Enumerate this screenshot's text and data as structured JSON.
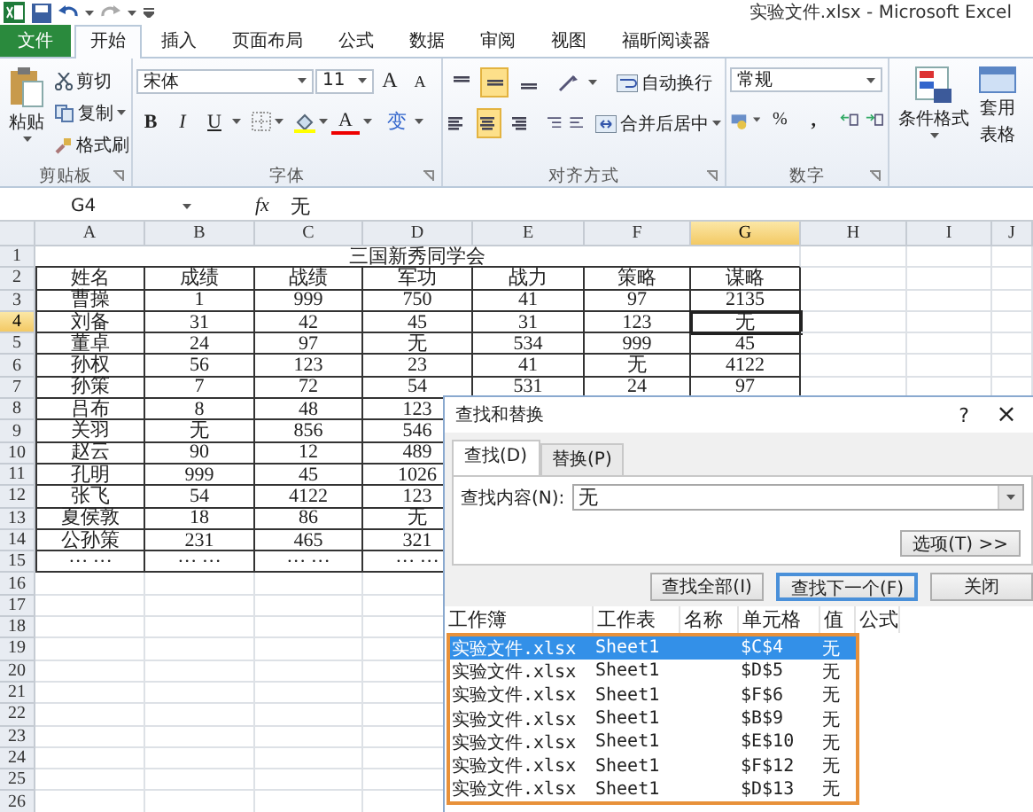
{
  "title_bar": {
    "title": "实验文件.xlsx - Microsoft Excel"
  },
  "ribbon_tabs": [
    {
      "label": "文件",
      "kind": "file",
      "selected": false
    },
    {
      "label": "开始",
      "kind": "tab",
      "selected": true
    },
    {
      "label": "插入",
      "kind": "tab",
      "selected": false
    },
    {
      "label": "页面布局",
      "kind": "tab",
      "selected": false
    },
    {
      "label": "公式",
      "kind": "tab",
      "selected": false
    },
    {
      "label": "数据",
      "kind": "tab",
      "selected": false
    },
    {
      "label": "审阅",
      "kind": "tab",
      "selected": false
    },
    {
      "label": "视图",
      "kind": "tab",
      "selected": false
    },
    {
      "label": "福昕阅读器",
      "kind": "tab",
      "selected": false
    }
  ],
  "clipboard": {
    "paste": "粘贴",
    "cut": "剪切",
    "copy": "复制",
    "format_painter": "格式刷",
    "group": "剪贴板"
  },
  "font": {
    "name": "宋体",
    "size": "11",
    "grow": "A",
    "shrink": "A",
    "bold": "B",
    "italic": "I",
    "underline": "U",
    "font_color_label": "A",
    "phonetic": "变",
    "group": "字体"
  },
  "alignment": {
    "vertical": [
      {
        "kind": "top",
        "selected": false
      },
      {
        "kind": "middle",
        "selected": true
      },
      {
        "kind": "bottom",
        "selected": false
      }
    ],
    "horizontal": [
      {
        "kind": "left",
        "selected": false
      },
      {
        "kind": "center",
        "selected": true
      },
      {
        "kind": "right",
        "selected": false
      }
    ],
    "wrap": "自动换行",
    "merge": "合并后居中",
    "group": "对齐方式"
  },
  "number": {
    "format": "常规",
    "percent": "%",
    "comma": ",",
    "group": "数字"
  },
  "styles": {
    "conditional": "条件格式",
    "table_format_top": "套用",
    "table_format_bottom": "表格"
  },
  "formula_bar": {
    "name_box": "G4",
    "function_label": "fx",
    "value": "无"
  },
  "sheet": {
    "title": "三国新秀同学会",
    "columns": [
      {
        "label": "A",
        "selected": false
      },
      {
        "label": "B",
        "selected": false
      },
      {
        "label": "C",
        "selected": false
      },
      {
        "label": "D",
        "selected": false
      },
      {
        "label": "E",
        "selected": false
      },
      {
        "label": "F",
        "selected": false
      },
      {
        "label": "G",
        "selected": true
      },
      {
        "label": "H",
        "selected": false
      },
      {
        "label": "I",
        "selected": false
      },
      {
        "label": "J",
        "selected": false
      }
    ],
    "rows": [
      {
        "label": "1",
        "selected": false
      },
      {
        "label": "2",
        "selected": false,
        "cells": [
          "姓名",
          "成绩",
          "战绩",
          "军功",
          "战力",
          "策略",
          "谋略"
        ]
      },
      {
        "label": "3",
        "selected": false,
        "cells": [
          "曹操",
          "1",
          "999",
          "750",
          "41",
          "97",
          "2135"
        ]
      },
      {
        "label": "4",
        "selected": true,
        "cells": [
          "刘备",
          "31",
          "42",
          "45",
          "31",
          "123",
          "无"
        ]
      },
      {
        "label": "5",
        "selected": false,
        "cells": [
          "董卓",
          "24",
          "97",
          "无",
          "534",
          "999",
          "45"
        ]
      },
      {
        "label": "6",
        "selected": false,
        "cells": [
          "孙权",
          "56",
          "123",
          "23",
          "41",
          "无",
          "4122"
        ]
      },
      {
        "label": "7",
        "selected": false,
        "cells": [
          "孙策",
          "7",
          "72",
          "54",
          "531",
          "24",
          "97"
        ]
      },
      {
        "label": "8",
        "selected": false,
        "cells": [
          "吕布",
          "8",
          "48",
          "123"
        ]
      },
      {
        "label": "9",
        "selected": false,
        "cells": [
          "关羽",
          "无",
          "856",
          "546"
        ]
      },
      {
        "label": "10",
        "selected": false,
        "cells": [
          "赵云",
          "90",
          "12",
          "489"
        ]
      },
      {
        "label": "11",
        "selected": false,
        "cells": [
          "孔明",
          "999",
          "45",
          "1026"
        ]
      },
      {
        "label": "12",
        "selected": false,
        "cells": [
          "张飞",
          "54",
          "4122",
          "123"
        ]
      },
      {
        "label": "13",
        "selected": false,
        "cells": [
          "夏侯敦",
          "18",
          "86",
          "无"
        ]
      },
      {
        "label": "14",
        "selected": false,
        "cells": [
          "公孙策",
          "231",
          "465",
          "321"
        ]
      },
      {
        "label": "15",
        "selected": false,
        "cells": [
          "··· ···",
          "··· ···",
          "··· ···",
          "··· ···"
        ]
      },
      {
        "label": "16",
        "selected": false
      },
      {
        "label": "17",
        "selected": false
      },
      {
        "label": "18",
        "selected": false
      },
      {
        "label": "19",
        "selected": false
      },
      {
        "label": "20",
        "selected": false
      },
      {
        "label": "21",
        "selected": false
      },
      {
        "label": "22",
        "selected": false
      },
      {
        "label": "23",
        "selected": false
      },
      {
        "label": "24",
        "selected": false
      },
      {
        "label": "25",
        "selected": false
      },
      {
        "label": "26",
        "selected": false
      }
    ]
  },
  "dialog": {
    "title": "查找和替换",
    "help": "?",
    "close": "×",
    "tabs": [
      {
        "label": "查找(D)",
        "selected": true
      },
      {
        "label": "替换(P)",
        "selected": false
      }
    ],
    "find_label": "查找内容(N):",
    "find_value": "无",
    "options_button": "选项(T) >>",
    "buttons": [
      {
        "label": "查找全部(I)",
        "focused": false
      },
      {
        "label": "查找下一个(F)",
        "focused": true
      },
      {
        "label": "关闭",
        "focused": false
      }
    ],
    "results": {
      "highlighted": true,
      "columns": [
        "工作簿",
        "工作表",
        "名称",
        "单元格",
        "值",
        "公式"
      ],
      "rows": [
        {
          "book": "实验文件.xlsx",
          "sheet": "Sheet1",
          "cell": "$C$4",
          "value": "无",
          "selected": true
        },
        {
          "book": "实验文件.xlsx",
          "sheet": "Sheet1",
          "cell": "$D$5",
          "value": "无",
          "selected": false
        },
        {
          "book": "实验文件.xlsx",
          "sheet": "Sheet1",
          "cell": "$F$6",
          "value": "无",
          "selected": false
        },
        {
          "book": "实验文件.xlsx",
          "sheet": "Sheet1",
          "cell": "$B$9",
          "value": "无",
          "selected": false
        },
        {
          "book": "实验文件.xlsx",
          "sheet": "Sheet1",
          "cell": "$E$10",
          "value": "无",
          "selected": false
        },
        {
          "book": "实验文件.xlsx",
          "sheet": "Sheet1",
          "cell": "$F$12",
          "value": "无",
          "selected": false
        },
        {
          "book": "实验文件.xlsx",
          "sheet": "Sheet1",
          "cell": "$D$13",
          "value": "无",
          "selected": false
        }
      ]
    }
  }
}
